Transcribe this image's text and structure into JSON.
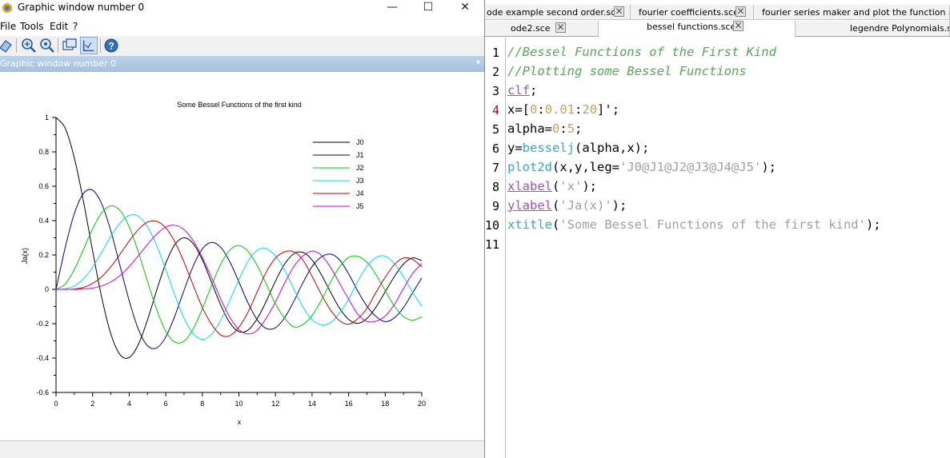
{
  "window": {
    "title": "Graphic window number 0",
    "dock_title": "Graphic window number 0",
    "controls": [
      "—",
      "☐",
      "✕"
    ]
  },
  "menubar": [
    "File",
    "Tools",
    "Edit",
    "?"
  ],
  "toolbar": [
    "rotate-icon",
    "zoom-in-icon",
    "zoom-out-icon",
    "datatip-icon",
    "edit-axes-icon",
    "help-icon"
  ],
  "chart_data": {
    "type": "line",
    "title": "Some Bessel Functions of the first kind",
    "xlabel": "x",
    "ylabel": "Ja(x)",
    "xlim": [
      0,
      20
    ],
    "ylim": [
      -0.6,
      1
    ],
    "xticks": [
      "0",
      "2",
      "4",
      "6",
      "8",
      "10",
      "12",
      "14",
      "16",
      "18",
      "20"
    ],
    "yticks": [
      "-0.6",
      "-0.4",
      "-0.2",
      "0",
      "0.2",
      "0.4",
      "0.6",
      "0.8",
      "1"
    ],
    "grid": false,
    "legend_position": "top-right",
    "x": [
      0,
      0.5,
      1,
      1.5,
      2,
      2.5,
      3,
      3.5,
      4,
      4.5,
      5,
      5.5,
      6,
      6.5,
      7,
      7.5,
      8,
      8.5,
      9,
      9.5,
      10,
      10.5,
      11,
      11.5,
      12,
      12.5,
      13,
      13.5,
      14,
      14.5,
      15,
      15.5,
      16,
      16.5,
      17,
      17.5,
      18,
      18.5,
      19,
      19.5,
      20
    ],
    "series": [
      {
        "name": "J0",
        "color": "#000000",
        "values": [
          1,
          0.938,
          0.765,
          0.512,
          0.224,
          -0.048,
          -0.26,
          -0.38,
          -0.397,
          -0.321,
          -0.178,
          -0.007,
          0.151,
          0.26,
          0.3,
          0.266,
          0.172,
          0.042,
          -0.09,
          -0.194,
          -0.246,
          -0.237,
          -0.171,
          -0.068,
          0.048,
          0.147,
          0.207,
          0.215,
          0.171,
          0.087,
          -0.014,
          -0.109,
          -0.175,
          -0.198,
          -0.17,
          -0.103,
          -0.014,
          0.074,
          0.147,
          0.183,
          0.167
        ]
      },
      {
        "name": "J1",
        "color": "#00008b",
        "values": [
          0,
          0.242,
          0.44,
          0.558,
          0.577,
          0.497,
          0.339,
          0.137,
          -0.066,
          -0.231,
          -0.328,
          -0.341,
          -0.277,
          -0.154,
          -0.005,
          0.135,
          0.235,
          0.273,
          0.245,
          0.161,
          0.043,
          -0.079,
          -0.177,
          -0.228,
          -0.223,
          -0.165,
          -0.07,
          0.038,
          0.133,
          0.188,
          0.205,
          0.172,
          0.09,
          -0.01,
          -0.098,
          -0.158,
          -0.188,
          -0.166,
          -0.106,
          -0.02,
          0.067
        ]
      },
      {
        "name": "J2",
        "color": "#00cc00",
        "values": [
          0,
          0.031,
          0.115,
          0.232,
          0.353,
          0.446,
          0.486,
          0.459,
          0.364,
          0.217,
          0.047,
          -0.117,
          -0.243,
          -0.307,
          -0.301,
          -0.23,
          -0.113,
          0.022,
          0.145,
          0.228,
          0.255,
          0.221,
          0.139,
          0.03,
          -0.085,
          -0.167,
          -0.218,
          -0.205,
          -0.152,
          -0.065,
          0.041,
          0.13,
          0.186,
          0.192,
          0.158,
          0.085,
          -0.008,
          -0.097,
          -0.158,
          -0.179,
          -0.16
        ]
      },
      {
        "name": "J3",
        "color": "#00e0e0",
        "values": [
          0,
          0.003,
          0.02,
          0.061,
          0.129,
          0.217,
          0.309,
          0.387,
          0.43,
          0.425,
          0.365,
          0.256,
          0.115,
          -0.035,
          -0.168,
          -0.258,
          -0.291,
          -0.262,
          -0.181,
          -0.065,
          0.058,
          0.164,
          0.227,
          0.236,
          0.195,
          0.112,
          0.003,
          -0.102,
          -0.177,
          -0.206,
          -0.194,
          -0.138,
          -0.057,
          0.047,
          0.135,
          0.186,
          0.193,
          0.15,
          0.074,
          -0.018,
          -0.099
        ]
      },
      {
        "name": "J4",
        "color": "#cc0000",
        "values": [
          0,
          0,
          0.002,
          0.011,
          0.034,
          0.074,
          0.132,
          0.204,
          0.281,
          0.348,
          0.391,
          0.396,
          0.358,
          0.276,
          0.158,
          0.024,
          -0.105,
          -0.202,
          -0.265,
          -0.27,
          -0.22,
          -0.132,
          -0.015,
          0.102,
          0.182,
          0.218,
          0.219,
          0.171,
          0.076,
          -0.028,
          -0.119,
          -0.182,
          -0.203,
          -0.171,
          -0.111,
          -0.016,
          0.07,
          0.144,
          0.182,
          0.174,
          0.131
        ]
      },
      {
        "name": "J5",
        "color": "#cc00cc",
        "values": [
          0,
          0,
          0,
          0.002,
          0.007,
          0.02,
          0.043,
          0.08,
          0.132,
          0.195,
          0.261,
          0.321,
          0.362,
          0.373,
          0.348,
          0.283,
          0.186,
          0.07,
          -0.055,
          -0.161,
          -0.234,
          -0.26,
          -0.238,
          -0.167,
          -0.073,
          0.036,
          0.132,
          0.194,
          0.223,
          0.199,
          0.13,
          0.036,
          -0.057,
          -0.144,
          -0.187,
          -0.185,
          -0.155,
          -0.089,
          0.005,
          0.092,
          0.151
        ]
      }
    ]
  },
  "editor": {
    "tabs_row1": [
      "ode example second order.sce",
      "fourier coefficients.sce",
      "fourier series maker and plot the function approx"
    ],
    "tabs_row2": [
      "ode2.sce",
      "bessel functions.sce",
      "legendre Polynomials.sce"
    ],
    "selected_tab": "bessel functions.sce",
    "line_numbers": [
      "1",
      "2",
      "3",
      "4",
      "5",
      "6",
      "7",
      "8",
      "9",
      "10",
      "11"
    ],
    "lines": [
      [
        {
          "t": "//Bessel Functions of the First Kind",
          "c": "cm"
        }
      ],
      [
        {
          "t": "//Plotting some Bessel Functions",
          "c": "cm"
        }
      ],
      [
        {
          "t": "clf",
          "c": "kw"
        },
        {
          "t": ";",
          "c": "op"
        }
      ],
      [
        {
          "t": "x=[",
          "c": "op"
        },
        {
          "t": "0",
          "c": "num"
        },
        {
          "t": ":",
          "c": "op"
        },
        {
          "t": "0.01",
          "c": "num"
        },
        {
          "t": ":",
          "c": "op"
        },
        {
          "t": "20",
          "c": "num"
        },
        {
          "t": "]';",
          "c": "op"
        }
      ],
      [
        {
          "t": "alpha=",
          "c": "op"
        },
        {
          "t": "0",
          "c": "num"
        },
        {
          "t": ":",
          "c": "op"
        },
        {
          "t": "5",
          "c": "num"
        },
        {
          "t": ";",
          "c": "op"
        }
      ],
      [
        {
          "t": "y=",
          "c": "op"
        },
        {
          "t": "besselj",
          "c": "fn"
        },
        {
          "t": "(alpha,x);",
          "c": "op"
        }
      ],
      [
        {
          "t": "plot2d",
          "c": "fn"
        },
        {
          "t": "(x,y,leg=",
          "c": "op"
        },
        {
          "t": "'J0@J1@J2@J3@J4@J5'",
          "c": "str"
        },
        {
          "t": ");",
          "c": "op"
        }
      ],
      [
        {
          "t": "xlabel",
          "c": "kw"
        },
        {
          "t": "(",
          "c": "op"
        },
        {
          "t": "'x'",
          "c": "str"
        },
        {
          "t": ");",
          "c": "op"
        }
      ],
      [
        {
          "t": "ylabel",
          "c": "kw"
        },
        {
          "t": "(",
          "c": "op"
        },
        {
          "t": "'Ja(x)'",
          "c": "str"
        },
        {
          "t": ");",
          "c": "op"
        }
      ],
      [
        {
          "t": "xtitle",
          "c": "fn"
        },
        {
          "t": "(",
          "c": "op"
        },
        {
          "t": "'Some Bessel Functions of the first kind'",
          "c": "str"
        },
        {
          "t": ");",
          "c": "op"
        }
      ],
      []
    ]
  }
}
